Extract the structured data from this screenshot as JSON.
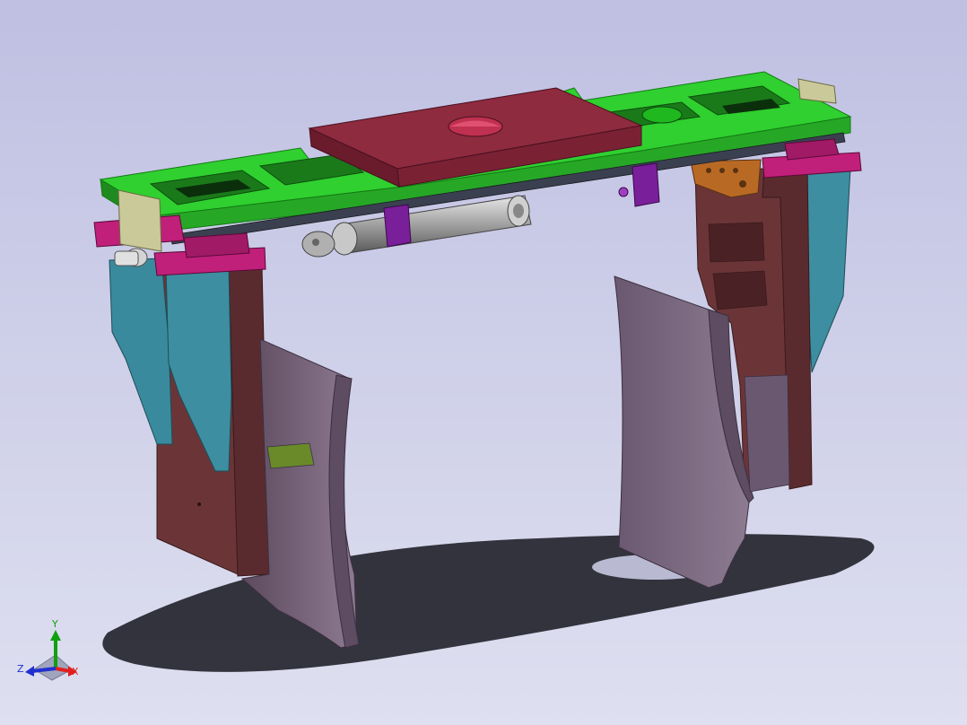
{
  "view": {
    "background_top": "#bfc0e2",
    "background_bottom": "#dedff0"
  },
  "triad": {
    "x_label": "X",
    "y_label": "Y",
    "z_label": "Z",
    "x_color": "#e02020",
    "y_color": "#10a010",
    "z_color": "#2030d0"
  },
  "parts": {
    "top_frame_color": "#2fd02f",
    "mount_plate_color": "#8e2b3f",
    "cylinder_color": "#b8b8b8",
    "bracket_color": "#7a1f9a",
    "slider_color": "#c0207a",
    "finger_color": "#3d8ea0",
    "arm_color": "#6b3538",
    "jaw_color": "#7d6a80",
    "end_block_color": "#c9c99a",
    "port_block_color": "#b86a25"
  }
}
